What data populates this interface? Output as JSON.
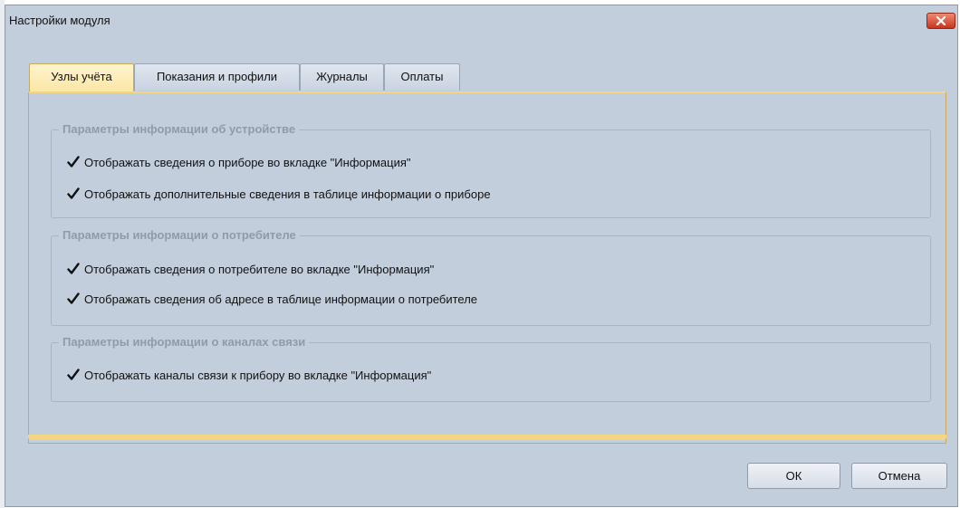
{
  "window": {
    "title": "Настройки модуля"
  },
  "tabs": [
    {
      "label": "Узлы учёта",
      "active": true
    },
    {
      "label": "Показания и профили",
      "active": false
    },
    {
      "label": "Журналы",
      "active": false
    },
    {
      "label": "Оплаты",
      "active": false
    }
  ],
  "groups": [
    {
      "title": "Параметры информации об устройстве",
      "items": [
        {
          "label": "Отображать сведения о приборе во вкладке \"Информация\"",
          "checked": true
        },
        {
          "label": "Отображать дополнительные сведения в таблице информации о приборе",
          "checked": true
        }
      ]
    },
    {
      "title": "Параметры информации о потребителе",
      "items": [
        {
          "label": "Отображать сведения о потребителе во вкладке \"Информация\"",
          "checked": true
        },
        {
          "label": "Отображать сведения об адресе в таблице информации о потребителе",
          "checked": true
        }
      ]
    },
    {
      "title": "Параметры информации о каналах связи",
      "items": [
        {
          "label": "Отображать каналы связи к прибору во вкладке \"Информация\"",
          "checked": true
        }
      ]
    }
  ],
  "buttons": {
    "ok": "ОК",
    "cancel": "Отмена"
  },
  "colors": {
    "window_bg": "#c3cedd",
    "active_tab": "#fbe6a4",
    "close_button": "#c6361c"
  }
}
